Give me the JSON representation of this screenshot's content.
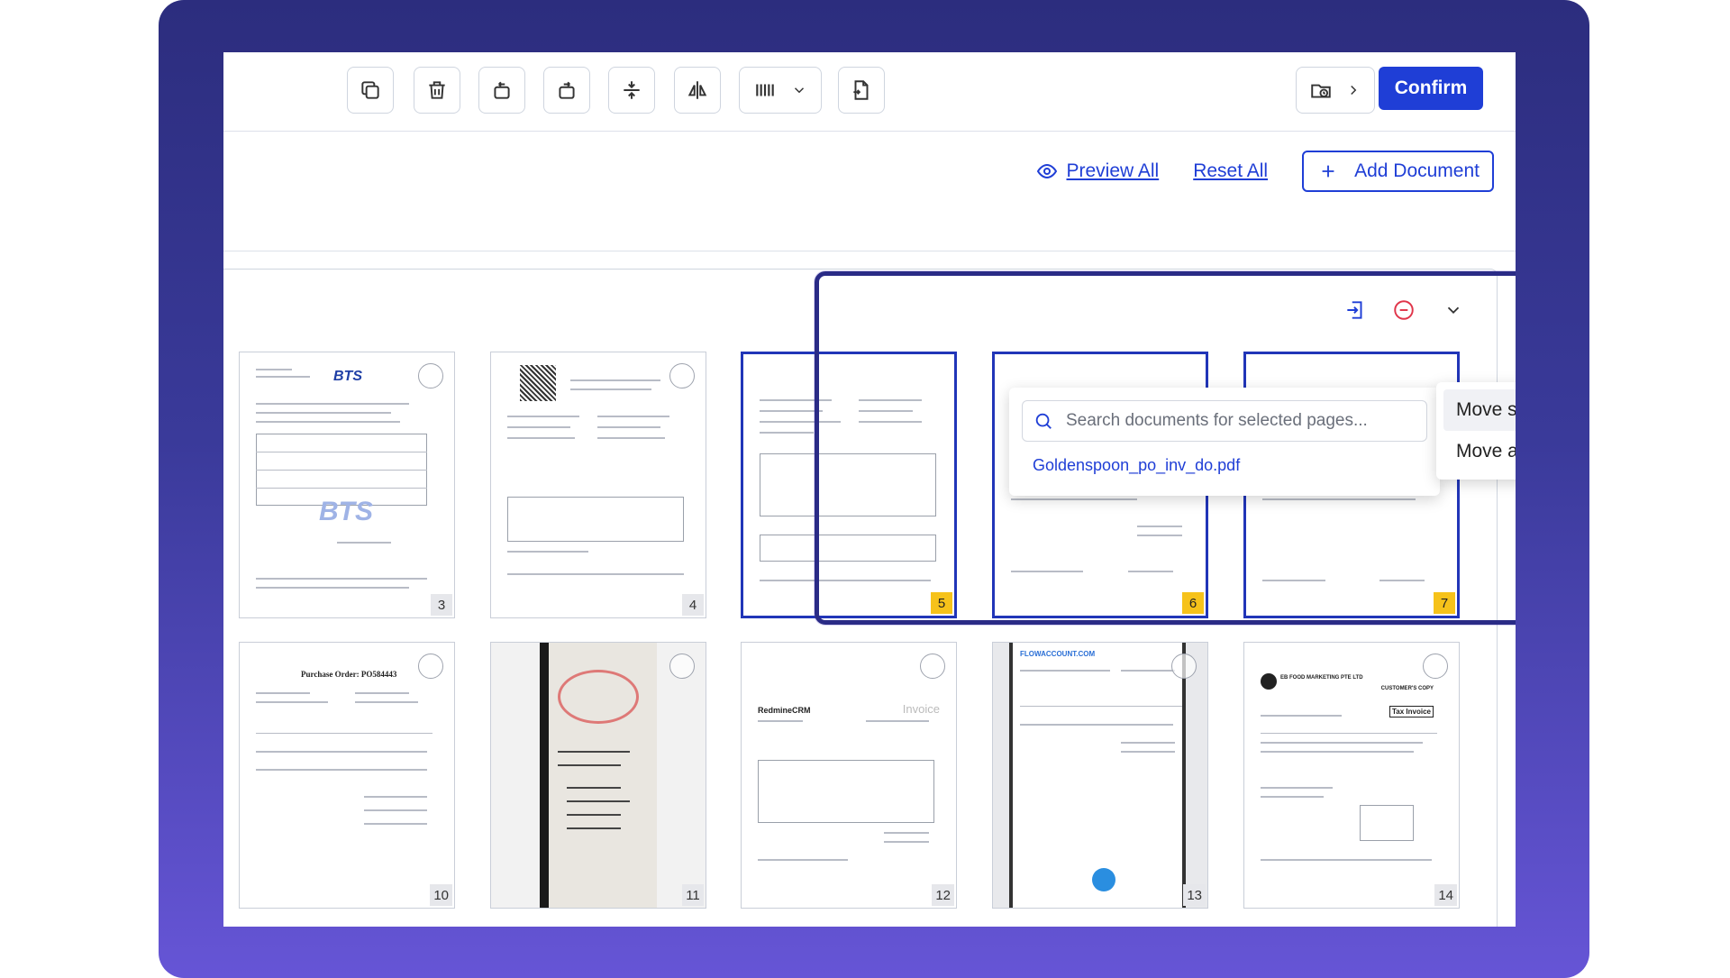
{
  "toolbar": {
    "buttons": [
      {
        "name": "copy-icon"
      },
      {
        "name": "trash-icon"
      },
      {
        "name": "rotate-left-icon"
      },
      {
        "name": "rotate-right-icon"
      },
      {
        "name": "split-icon"
      },
      {
        "name": "mirror-icon"
      },
      {
        "name": "barcode-icon"
      },
      {
        "name": "file-add-icon"
      }
    ],
    "folder_icon": "folder-clock-icon",
    "confirm_label": "Confirm"
  },
  "actions": {
    "preview_all": "Preview All",
    "reset_all": "Reset All",
    "add_document": "Add Document"
  },
  "search": {
    "placeholder": "Search documents for selected pages...",
    "results": [
      "Goldenspoon_po_inv_do.pdf"
    ]
  },
  "move_menu": {
    "items": [
      "Move selected Pages",
      "Move all pages"
    ]
  },
  "pages": [
    {
      "number": "3",
      "selected": false
    },
    {
      "number": "4",
      "selected": false
    },
    {
      "number": "5",
      "selected": true
    },
    {
      "number": "6",
      "selected": true
    },
    {
      "number": "7",
      "selected": true
    },
    {
      "number": "10",
      "selected": false
    },
    {
      "number": "11",
      "selected": false
    },
    {
      "number": "12",
      "selected": false
    },
    {
      "number": "13",
      "selected": false
    },
    {
      "number": "14",
      "selected": false
    }
  ],
  "doc_text": {
    "bts_logo": "BTS",
    "po_title": "Purchase Order: PO584443",
    "redmine": "RedmineCRM",
    "invoice": "Invoice",
    "flowaccount": "FLOWACCOUNT.COM",
    "eb_company": "EB FOOD MARKETING PTE LTD",
    "customer_copy": "CUSTOMER'S COPY",
    "tax_invoice": "Tax Invoice"
  },
  "colors": {
    "accent": "#1f3ed6",
    "selected_border": "#2135b8",
    "selected_badge": "#f6c21a",
    "frame_top": "#2c2d7e",
    "frame_bottom": "#6655d6"
  }
}
